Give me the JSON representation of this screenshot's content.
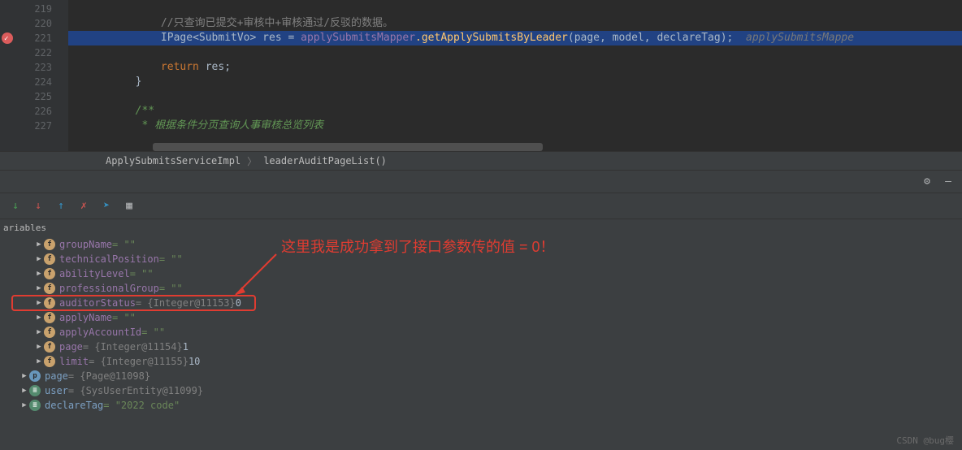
{
  "editor": {
    "lines": [
      "219",
      "220",
      "221",
      "222",
      "223",
      "224",
      "225",
      "226",
      "227"
    ],
    "code": {
      "comment_submit": "//只查询已提交+审核中+审核通过/反驳的数据。",
      "type_ipage": "IPage",
      "type_submitvo": "SubmitVo",
      "var_res": "res",
      "op_eq": " = ",
      "mapper": "applySubmitsMapper",
      "method_get": ".getApplySubmitsByLeader",
      "params": "(page, model, declareTag);",
      "hint": "  applySubmitsMappe",
      "kw_return": "return",
      "ret_stmt": " res;",
      "brace": "}",
      "doc1": "/**",
      "doc2": " * 根据条件分页查询人事审核总览列表",
      "doc3": " */"
    }
  },
  "breadcrumb": {
    "item1": "ApplySubmitsServiceImpl",
    "sep": "〉",
    "item2": "leaderAuditPageList()"
  },
  "debug": {
    "tab": "ariables",
    "vars": [
      {
        "icon": "f",
        "name": "groupName",
        "val": " = \"\"",
        "indent": 2
      },
      {
        "icon": "f",
        "name": "technicalPosition",
        "val": " = \"\"",
        "indent": 2
      },
      {
        "icon": "f",
        "name": "abilityLevel",
        "val": " = \"\"",
        "indent": 2
      },
      {
        "icon": "f",
        "name": "professionalGroup",
        "val": " = \"\"",
        "indent": 2
      },
      {
        "icon": "f",
        "name": "auditorStatus",
        "type": " = {Integer@11153} ",
        "num": "0",
        "indent": 2
      },
      {
        "icon": "f",
        "name": "applyName",
        "val": " = \"\"",
        "indent": 2
      },
      {
        "icon": "f",
        "name": "applyAccountId",
        "val": " = \"\"",
        "indent": 2
      },
      {
        "icon": "f",
        "name": "page",
        "type": " = {Integer@11154} ",
        "num": "1",
        "indent": 2
      },
      {
        "icon": "f",
        "name": "limit",
        "type": " = {Integer@11155} ",
        "num": "10",
        "indent": 2
      }
    ],
    "rootvars": [
      {
        "icon": "p",
        "name": "page",
        "type": " = {Page@11098}",
        "indent": 1
      },
      {
        "icon": "e",
        "name": "user",
        "type": " = {SysUserEntity@11099}",
        "indent": 1
      },
      {
        "icon": "e",
        "name": "declareTag",
        "val": " = \"2022 code\"",
        "indent": 1
      }
    ]
  },
  "annotation": {
    "text": "这里我是成功拿到了接口参数传的值 = 0！"
  },
  "watermark": "CSDN @bug樱"
}
